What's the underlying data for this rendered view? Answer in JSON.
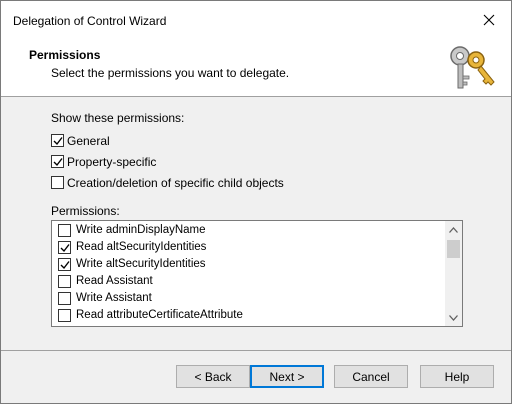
{
  "window": {
    "title": "Delegation of Control Wizard"
  },
  "header": {
    "title": "Permissions",
    "subtitle": "Select the permissions you want to delegate.",
    "icon": "keys-icon"
  },
  "show_section": {
    "label": "Show these permissions:",
    "options": [
      {
        "label": "General",
        "checked": true
      },
      {
        "label": "Property-specific",
        "checked": true
      },
      {
        "label": "Creation/deletion of specific child objects",
        "checked": false
      }
    ]
  },
  "permissions": {
    "label": "Permissions:",
    "items": [
      {
        "label": "Write adminDisplayName",
        "checked": false
      },
      {
        "label": "Read altSecurityIdentities",
        "checked": true
      },
      {
        "label": "Write altSecurityIdentities",
        "checked": true
      },
      {
        "label": "Read Assistant",
        "checked": false
      },
      {
        "label": "Write Assistant",
        "checked": false
      },
      {
        "label": "Read attributeCertificateAttribute",
        "checked": false
      }
    ]
  },
  "buttons": {
    "back": "< Back",
    "next": "Next >",
    "cancel": "Cancel",
    "help": "Help"
  }
}
